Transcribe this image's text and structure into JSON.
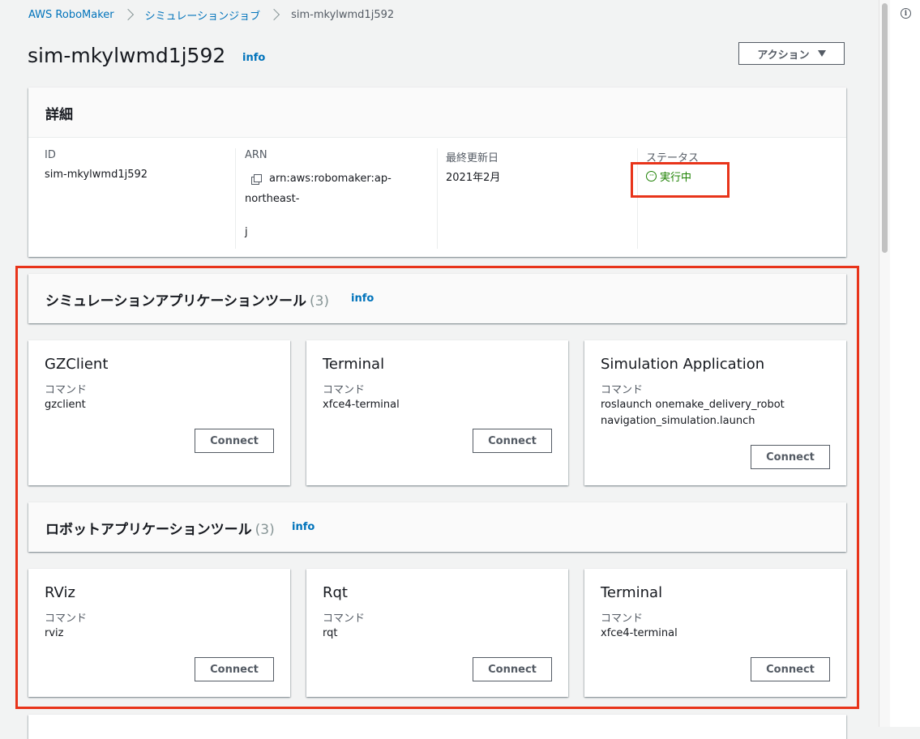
{
  "breadcrumb": [
    "AWS RoboMaker",
    "シミュレーションジョブ",
    "sim-mkylwmd1j592"
  ],
  "title": "sim-mkylwmd1j592",
  "info_link": "info",
  "actions_label": "アクション",
  "details": {
    "header": "詳細",
    "id_label": "ID",
    "id_value": "sim-mkylwmd1j592",
    "arn_label": "ARN",
    "arn_line1": "arn:aws:robomaker:ap-",
    "arn_line2": "northeast-",
    "arn_line3": "j",
    "updated_label": "最終更新日",
    "updated_value": "2021年2月",
    "status_label": "ステータス",
    "status_value": "実行中"
  },
  "sim_tools": {
    "title": "シミュレーションアプリケーションツール",
    "count": "(3)",
    "info": "info",
    "command_label": "コマンド",
    "connect_label": "Connect",
    "items": [
      {
        "name": "GZClient",
        "command": "gzclient"
      },
      {
        "name": "Terminal",
        "command": "xfce4-terminal"
      },
      {
        "name": "Simulation Application",
        "command_line1": "roslaunch onemake_delivery_robot",
        "command_line2": "navigation_simulation.launch"
      }
    ]
  },
  "robot_tools": {
    "title": "ロボットアプリケーションツール",
    "count": "(3)",
    "info": "info",
    "command_label": "コマンド",
    "connect_label": "Connect",
    "items": [
      {
        "name": "RViz",
        "command": "rviz"
      },
      {
        "name": "Rqt",
        "command": "rqt"
      },
      {
        "name": "Terminal",
        "command": "xfce4-terminal"
      }
    ]
  },
  "colors": {
    "link": "#0073bb",
    "status_green": "#1d8102",
    "highlight": "#e8341a"
  },
  "icons": [
    "chevron-right-icon",
    "caret-down-icon",
    "copy-icon",
    "status-in-progress-icon",
    "info-circle-icon"
  ]
}
